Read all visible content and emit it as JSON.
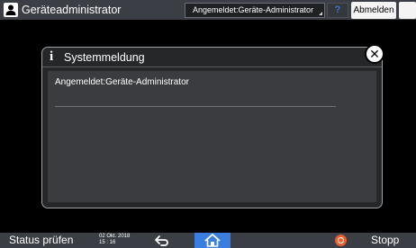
{
  "topbar": {
    "user_name": "Geräteadministrator",
    "user_icon": "user-icon",
    "login_status": "Angemeldet:Geräte-Administrator",
    "help_label": "?",
    "logout_label": "Abmelden",
    "night_icon": "moon-icon"
  },
  "dialog": {
    "icon": "info-icon",
    "title": "Systemmeldung",
    "message": "Angemeldet:Geräte-Administrator",
    "close_icon": "close-icon"
  },
  "bottombar": {
    "status_label": "Status prüfen",
    "date": "02 Okt. 2018",
    "time": "15 : 16",
    "back_icon": "back-icon",
    "home_icon": "home-icon",
    "stop_icon": "stop-icon",
    "stop_label": "Stopp"
  },
  "colors": {
    "bar_bg": "#3b3f45",
    "home_accent": "#3a7ee0",
    "stop_accent": "#e8602e"
  }
}
